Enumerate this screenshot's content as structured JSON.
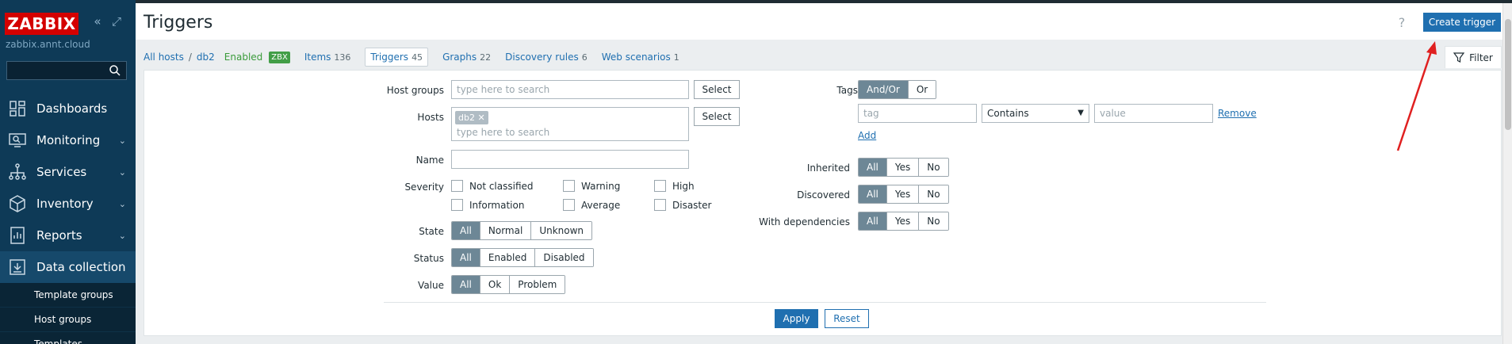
{
  "sidebar": {
    "logo": "ZABBIX",
    "server": "zabbix.annt.cloud",
    "nav": [
      {
        "label": "Dashboards",
        "icon": "dashboard-icon",
        "chevron": ""
      },
      {
        "label": "Monitoring",
        "icon": "monitoring-icon",
        "chevron": "⌄"
      },
      {
        "label": "Services",
        "icon": "services-icon",
        "chevron": "⌄"
      },
      {
        "label": "Inventory",
        "icon": "inventory-icon",
        "chevron": "⌄"
      },
      {
        "label": "Reports",
        "icon": "reports-icon",
        "chevron": "⌄"
      },
      {
        "label": "Data collection",
        "icon": "data-collection-icon",
        "chevron": "⌃"
      }
    ],
    "submenu": [
      "Template groups",
      "Host groups",
      "Templates"
    ]
  },
  "header": {
    "title": "Triggers",
    "help": "?",
    "create_label": "Create trigger"
  },
  "breadcrumb": {
    "all_hosts": "All hosts",
    "sep": "/",
    "host": "db2",
    "enabled": "Enabled",
    "zbx": "ZBX"
  },
  "tabs": [
    {
      "label": "Items",
      "count": "136"
    },
    {
      "label": "Triggers",
      "count": "45"
    },
    {
      "label": "Graphs",
      "count": "22"
    },
    {
      "label": "Discovery rules",
      "count": "6"
    },
    {
      "label": "Web scenarios",
      "count": "1"
    }
  ],
  "filter_tab": "Filter",
  "filter": {
    "host_groups": {
      "label": "Host groups",
      "placeholder": "type here to search",
      "select": "Select"
    },
    "hosts": {
      "label": "Hosts",
      "chip": "db2 ✕",
      "placeholder": "type here to search",
      "select": "Select"
    },
    "name": {
      "label": "Name"
    },
    "severity": {
      "label": "Severity",
      "options": [
        "Not classified",
        "Warning",
        "High",
        "Information",
        "Average",
        "Disaster"
      ]
    },
    "state": {
      "label": "State",
      "options": [
        "All",
        "Normal",
        "Unknown"
      ]
    },
    "status": {
      "label": "Status",
      "options": [
        "All",
        "Enabled",
        "Disabled"
      ]
    },
    "value": {
      "label": "Value",
      "options": [
        "All",
        "Ok",
        "Problem"
      ]
    },
    "tags": {
      "label": "Tags",
      "options": [
        "And/Or",
        "Or"
      ],
      "tag_placeholder": "tag",
      "operator": "Contains",
      "value_placeholder": "value",
      "remove": "Remove",
      "add": "Add"
    },
    "inherited": {
      "label": "Inherited",
      "options": [
        "All",
        "Yes",
        "No"
      ]
    },
    "discovered": {
      "label": "Discovered",
      "options": [
        "All",
        "Yes",
        "No"
      ]
    },
    "with_dependencies": {
      "label": "With dependencies",
      "options": [
        "All",
        "Yes",
        "No"
      ]
    },
    "apply": "Apply",
    "reset": "Reset"
  },
  "colors": {
    "sidebar": "#0e3a57",
    "accent": "#1f6fb0",
    "logo": "#d40000",
    "enabled": "#3a9b3a",
    "segment_on": "#6d8796",
    "annotation_arrow": "#e02020"
  }
}
